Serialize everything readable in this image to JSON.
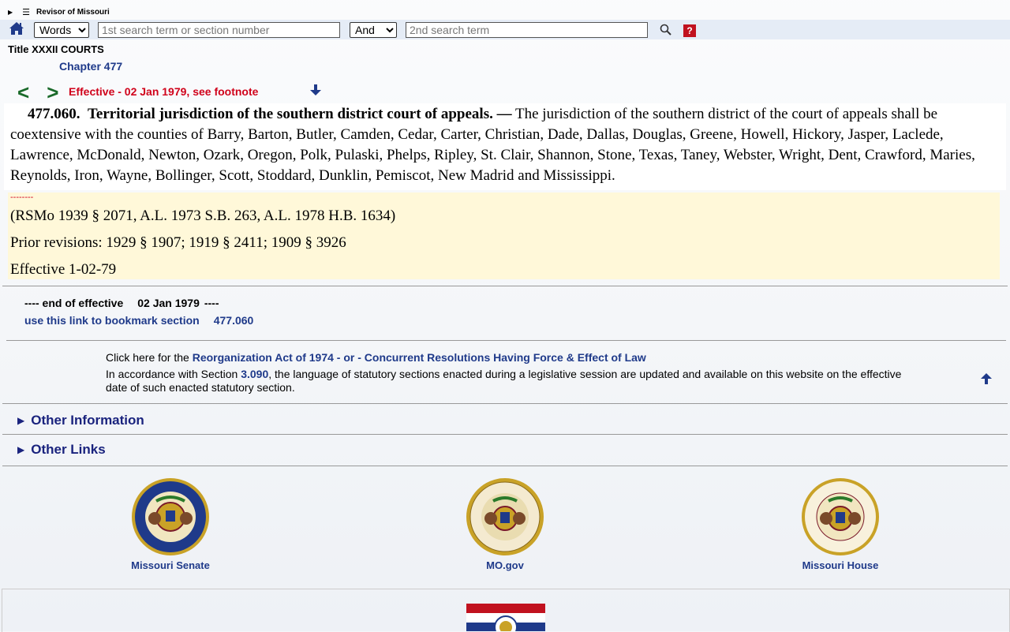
{
  "header": {
    "site_title": "Revisor of Missouri",
    "search": {
      "mode_options": [
        "Words"
      ],
      "mode_selected": "Words",
      "term1_placeholder": "1st search term or section number",
      "operator_selected": "And",
      "term2_placeholder": "2nd search term",
      "help_label": "?"
    }
  },
  "breadcrumb": {
    "title": "Title XXXII COURTS",
    "chapter": "Chapter 477"
  },
  "nav": {
    "prev": "<",
    "next": ">",
    "effective": "Effective - 02 Jan 1979, see footnote"
  },
  "statute": {
    "number": "477.060.",
    "heading": "Territorial jurisdiction of the southern district court of appeals. —",
    "text": " The jurisdiction of the southern district of the court of appeals shall be coextensive with the counties of Barry, Barton, Butler, Camden, Cedar, Carter, Christian, Dade, Dallas, Douglas, Greene, Howell, Hickory, Jasper, Laclede, Lawrence, McDonald, Newton, Ozark, Oregon, Polk, Pulaski, Phelps, Ripley, St. Clair, Shannon, Stone, Texas, Taney, Webster, Wright, Dent, Crawford, Maries, Reynolds, Iron, Wayne, Bollinger, Scott, Stoddard, Dunklin, Pemiscot, New Madrid and Mississippi."
  },
  "history": {
    "separator": "--------",
    "source": "(RSMo 1939 § 2071, A.L. 1973 S.B. 263, A.L. 1978 H.B. 1634)",
    "prior": "Prior revisions: 1929 § 1907; 1919 § 2411; 1909 § 3926",
    "effective": "Effective 1-02-79"
  },
  "end_effective": {
    "prefix": "---- end of effective",
    "date": "02 Jan 1979",
    "suffix": "----"
  },
  "bookmark": {
    "label": "use this link to bookmark section",
    "section": "477.060"
  },
  "footer_info": {
    "click_here": "Click here for the",
    "reorg_link": "Reorganization Act of 1974 - or - Concurrent Resolutions Having Force & Effect of Law",
    "accord_prefix": "In accordance with Section",
    "accord_link": "3.090",
    "accord_suffix": ", the language of statutory sections enacted during a legislative session are updated and available on this website on the effective date of such enacted statutory section."
  },
  "sections": {
    "other_information": "Other Information",
    "other_links": "Other Links"
  },
  "seals": [
    {
      "label": "Missouri Senate",
      "ring_text": "MISSOURI SENATE",
      "ring_color": "#1f3a8a",
      "icon": "senate-seal-icon"
    },
    {
      "label": "MO.gov",
      "ring_text": "THE GREAT SEAL OF THE STATE OF MISSOURI",
      "ring_color": "#c9a227",
      "icon": "state-seal-icon"
    },
    {
      "label": "Missouri House",
      "ring_text": "MISSOURI HOUSE OF REPRESENTATIVES",
      "ring_color": "#7a1a2a",
      "icon": "house-seal-icon"
    }
  ],
  "colors": {
    "link": "#1f3a8a",
    "alert": "#d0021b",
    "nav_arrows": "#1a6a2a",
    "history_bg": "#fff8d9"
  }
}
